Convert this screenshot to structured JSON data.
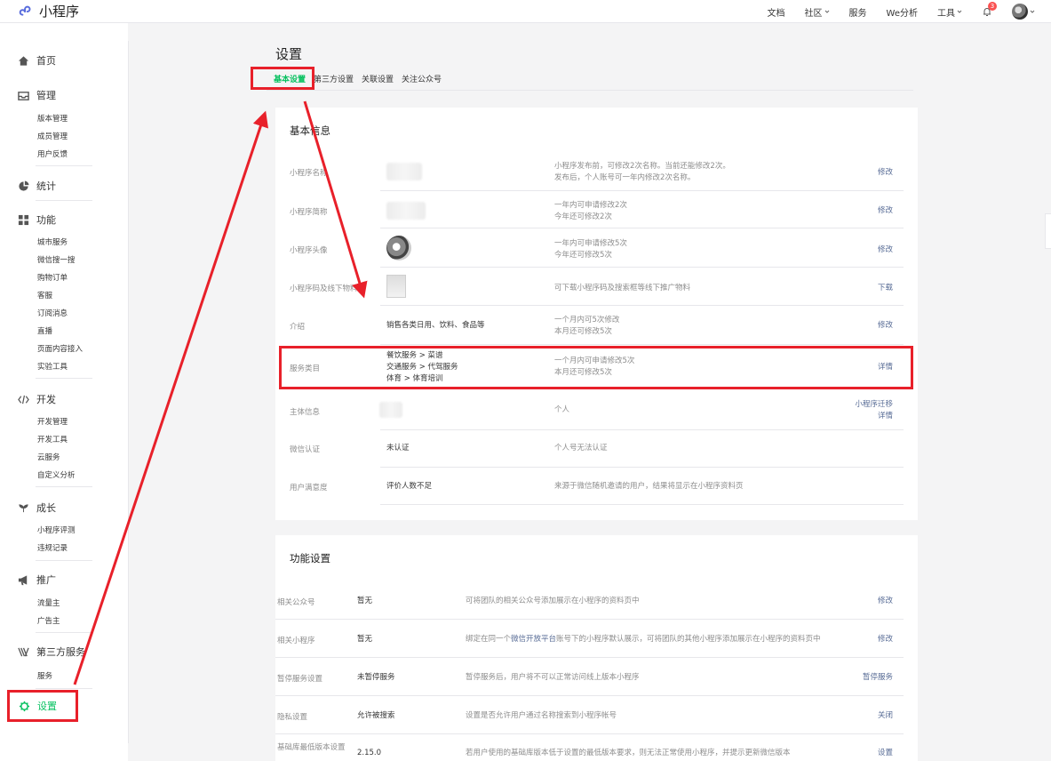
{
  "app": {
    "name": "小程序"
  },
  "topnav": {
    "docs": "文档",
    "community": "社区",
    "service": "服务",
    "analysis": "We分析",
    "tools": "工具",
    "notify_count": "3"
  },
  "sidebar": {
    "home": "首页",
    "manage": {
      "label": "管理",
      "items": [
        "版本管理",
        "成员管理",
        "用户反馈"
      ]
    },
    "stats": "统计",
    "features": {
      "label": "功能",
      "items": [
        "城市服务",
        "微信搜一搜",
        "购物订单",
        "客服",
        "订阅消息",
        "直播",
        "页面内容接入",
        "实验工具"
      ]
    },
    "dev": {
      "label": "开发",
      "items": [
        "开发管理",
        "开发工具",
        "云服务",
        "自定义分析"
      ]
    },
    "growth": {
      "label": "成长",
      "items": [
        "小程序评测",
        "违规记录"
      ]
    },
    "promo": {
      "label": "推广",
      "items": [
        "流量主",
        "广告主"
      ]
    },
    "third": {
      "label": "第三方服务",
      "items": [
        "服务"
      ]
    },
    "settings": "设置"
  },
  "page": {
    "title": "设置",
    "tabs": [
      "基本设置",
      "第三方设置",
      "关联设置",
      "关注公众号"
    ]
  },
  "basic": {
    "title": "基本信息",
    "rows": [
      {
        "label": "小程序名称",
        "value": "",
        "desc1": "小程序发布前，可修改2次名称。当前还能修改2次。",
        "desc2": "发布后，个人账号可一年内修改2次名称。",
        "action": "修改"
      },
      {
        "label": "小程序简称",
        "value": "",
        "desc1": "一年内可申请修改2次",
        "desc2": "今年还可修改2次",
        "action": "修改"
      },
      {
        "label": "小程序头像",
        "value": "",
        "desc1": "一年内可申请修改5次",
        "desc2": "今年还可修改5次",
        "action": "修改"
      },
      {
        "label": "小程序码及线下物料",
        "value": "",
        "desc1": "可下载小程序码及搜索框等线下推广物料",
        "desc2": "",
        "action": "下载"
      },
      {
        "label": "介绍",
        "value": "销售各类日用、饮料、食品等",
        "desc1": "一个月内可5次修改",
        "desc2": "本月还可修改5次",
        "action": "修改"
      },
      {
        "label": "服务类目",
        "value1": "餐饮服务 > 菜谱",
        "value2": "交通服务 > 代驾服务",
        "value3": "体育 > 体育培训",
        "desc1": "一个月内可申请修改5次",
        "desc2": "本月还可修改5次",
        "action": "详情"
      },
      {
        "label": "主体信息",
        "value": "",
        "desc1": "个人",
        "desc2": "",
        "action1": "小程序迁移",
        "action2": "详情"
      },
      {
        "label": "微信认证",
        "value": "未认证",
        "desc1": "个人号无法认证",
        "desc2": "",
        "action": ""
      },
      {
        "label": "用户满意度",
        "value": "评价人数不足",
        "desc1": "来源于微信随机邀请的用户，结果将显示在小程序资料页",
        "desc2": "",
        "action": ""
      }
    ]
  },
  "func": {
    "title": "功能设置",
    "rows": [
      {
        "label": "相关公众号",
        "value": "暂无",
        "desc": "可将团队的相关公众号添加展示在小程序的资料页中",
        "action": "修改"
      },
      {
        "label": "相关小程序",
        "value": "暂无",
        "desc_pre": "绑定在同一个",
        "desc_link": "微信开放平台",
        "desc_post": "账号下的小程序默认展示，可将团队的其他小程序添加展示在小程序的资料页中",
        "action": "修改"
      },
      {
        "label": "暂停服务设置",
        "value": "未暂停服务",
        "desc": "暂停服务后，用户将不可以正常访问线上版本小程序",
        "action": "暂停服务"
      },
      {
        "label": "隐私设置",
        "value": "允许被搜索",
        "desc": "设置是否允许用户通过名称搜索到小程序帐号",
        "action": "关闭"
      },
      {
        "label": "基础库最低版本设置",
        "value": "2.15.0",
        "desc": "若用户使用的基础库版本低于设置的最低版本要求，则无法正常使用小程序，并提示更新微信版本",
        "action": "设置"
      }
    ]
  }
}
